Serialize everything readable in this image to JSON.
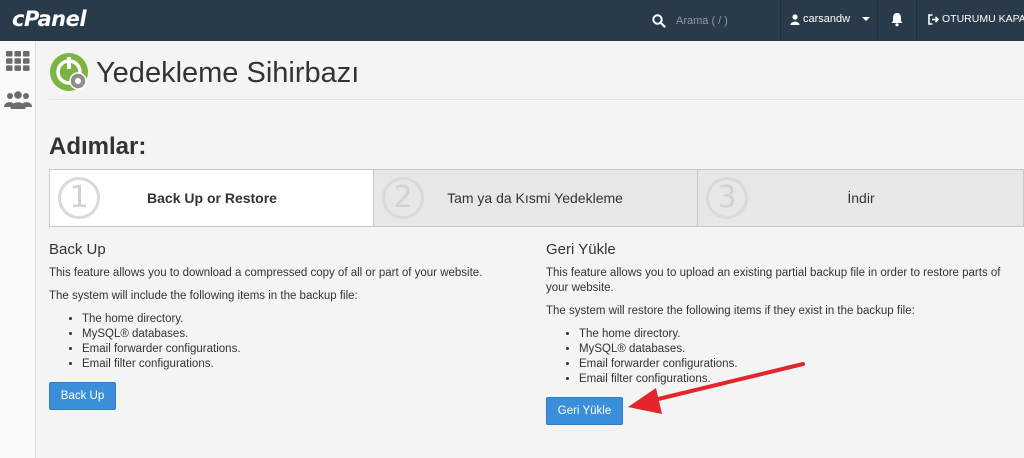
{
  "topbar": {
    "logo": "cPanel",
    "search_placeholder": "Arama ( / )",
    "username": "carsandw",
    "logout_label": "OTURUMU KAPAT"
  },
  "page": {
    "title": "Yedekleme Sihirbazı",
    "steps_title": "Adımlar:"
  },
  "steps": [
    {
      "number": "1",
      "label": "Back Up or Restore"
    },
    {
      "number": "2",
      "label": "Tam ya da Kısmi Yedekleme"
    },
    {
      "number": "3",
      "label": "İndir"
    }
  ],
  "backup": {
    "heading": "Back Up",
    "description": "This feature allows you to download a compressed copy of all or part of your website.",
    "items_intro": "The system will include the following items in the backup file:",
    "items": [
      "The home directory.",
      "MySQL® databases.",
      "Email forwarder configurations.",
      "Email filter configurations."
    ],
    "button": "Back Up"
  },
  "restore": {
    "heading": "Geri Yükle",
    "description": "This feature allows you to upload an existing partial backup file in order to restore parts of your website.",
    "items_intro": "The system will restore the following items if they exist in the backup file:",
    "items": [
      "The home directory.",
      "MySQL® databases.",
      "Email forwarder configurations.",
      "Email filter configurations."
    ],
    "button": "Geri Yükle"
  },
  "colors": {
    "topbar": "#293a4a",
    "button": "#3b8fd8",
    "annotation_arrow": "#e3262c"
  }
}
